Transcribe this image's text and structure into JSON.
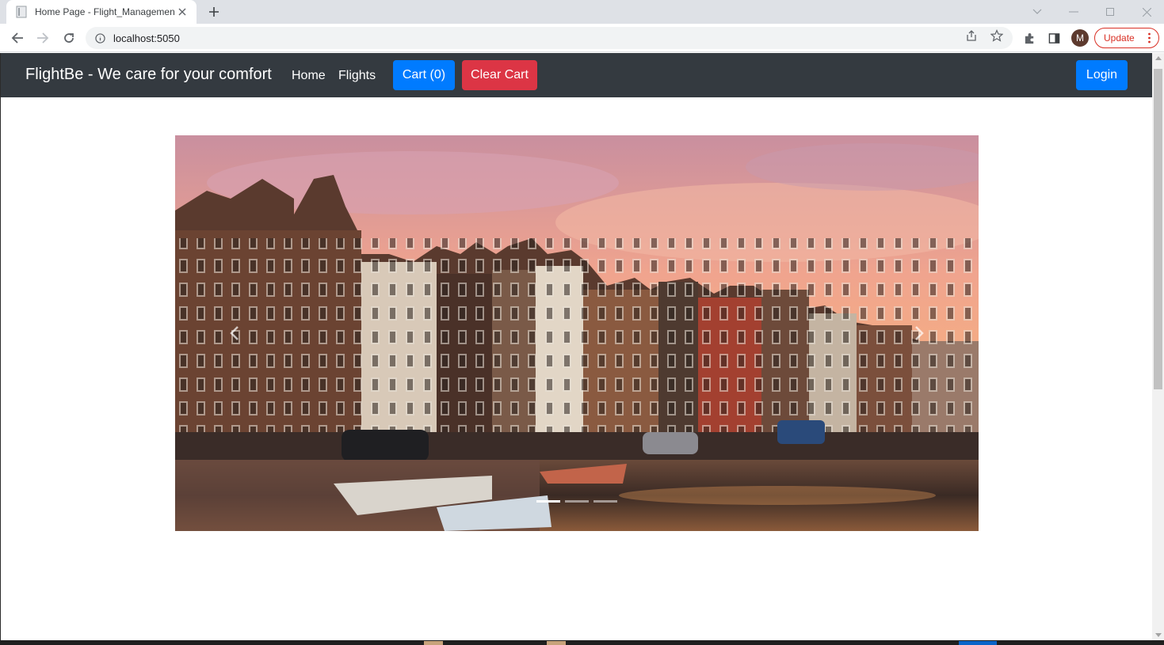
{
  "browser": {
    "tab_title": "Home Page - Flight_Managemen",
    "url": "localhost:5050",
    "profile_initial": "M",
    "update_label": "Update"
  },
  "navbar": {
    "brand": "FlightBe - We care for your comfort",
    "links": [
      {
        "label": "Home"
      },
      {
        "label": "Flights"
      }
    ],
    "cart_label": "Cart (0)",
    "clear_cart_label": "Clear Cart",
    "login_label": "Login"
  },
  "carousel": {
    "slides": 3,
    "active_slide": 1
  },
  "colors": {
    "navbar_bg": "#343a40",
    "primary": "#007bff",
    "danger": "#dc3545"
  }
}
